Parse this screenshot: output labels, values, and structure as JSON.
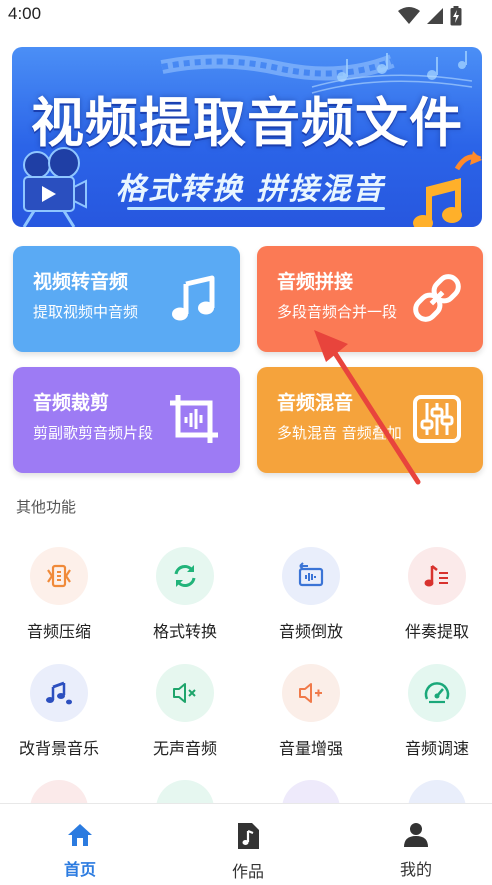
{
  "status_bar": {
    "time": "4:00"
  },
  "banner": {
    "title": "视频提取音频文件",
    "subtitle": "格式转换 拼接混音"
  },
  "cards": [
    {
      "title": "视频转音频",
      "desc": "提取视频中音频",
      "color": "#5aaaf4",
      "icon": "music-note-icon"
    },
    {
      "title": "音频拼接",
      "desc": "多段音频合并一段",
      "color": "#fb7a55",
      "icon": "chain-link-icon"
    },
    {
      "title": "音频裁剪",
      "desc": "剪副歌剪音频片段",
      "color": "#9d7bf4",
      "icon": "crop-icon"
    },
    {
      "title": "音频混音",
      "desc": "多轨混音 音频叠加",
      "color": "#f5a33c",
      "icon": "mixer-sliders-icon"
    }
  ],
  "other_section": {
    "label": "其他功能"
  },
  "features": [
    {
      "label": "音频压缩",
      "icon": "compress-icon",
      "bg": "#fdf0ea",
      "color": "#f08a3a"
    },
    {
      "label": "格式转换",
      "icon": "convert-icon",
      "bg": "#e6f7f0",
      "color": "#21b47a"
    },
    {
      "label": "音频倒放",
      "icon": "reverse-icon",
      "bg": "#e9eefb",
      "color": "#3b74d6"
    },
    {
      "label": "伴奏提取",
      "icon": "accompaniment-icon",
      "bg": "#fbeaea",
      "color": "#d8322e"
    },
    {
      "label": "改背景音乐",
      "icon": "notes-icon",
      "bg": "#eaeefb",
      "color": "#2c4fbf"
    },
    {
      "label": "无声音频",
      "icon": "mute-icon",
      "bg": "#e6f7ef",
      "color": "#1ea56b"
    },
    {
      "label": "音量增强",
      "icon": "volume-up-icon",
      "bg": "#fbeee8",
      "color": "#f07a4a"
    },
    {
      "label": "音频调速",
      "icon": "speed-gauge-icon",
      "bg": "#e4f7f0",
      "color": "#1aa87a"
    }
  ],
  "bottom_nav": [
    {
      "label": "首页",
      "icon": "home-icon",
      "active": true,
      "color": "#2b7be0"
    },
    {
      "label": "作品",
      "icon": "music-file-icon",
      "active": false,
      "color": "#333333"
    },
    {
      "label": "我的",
      "icon": "person-icon",
      "active": false,
      "color": "#333333"
    }
  ]
}
